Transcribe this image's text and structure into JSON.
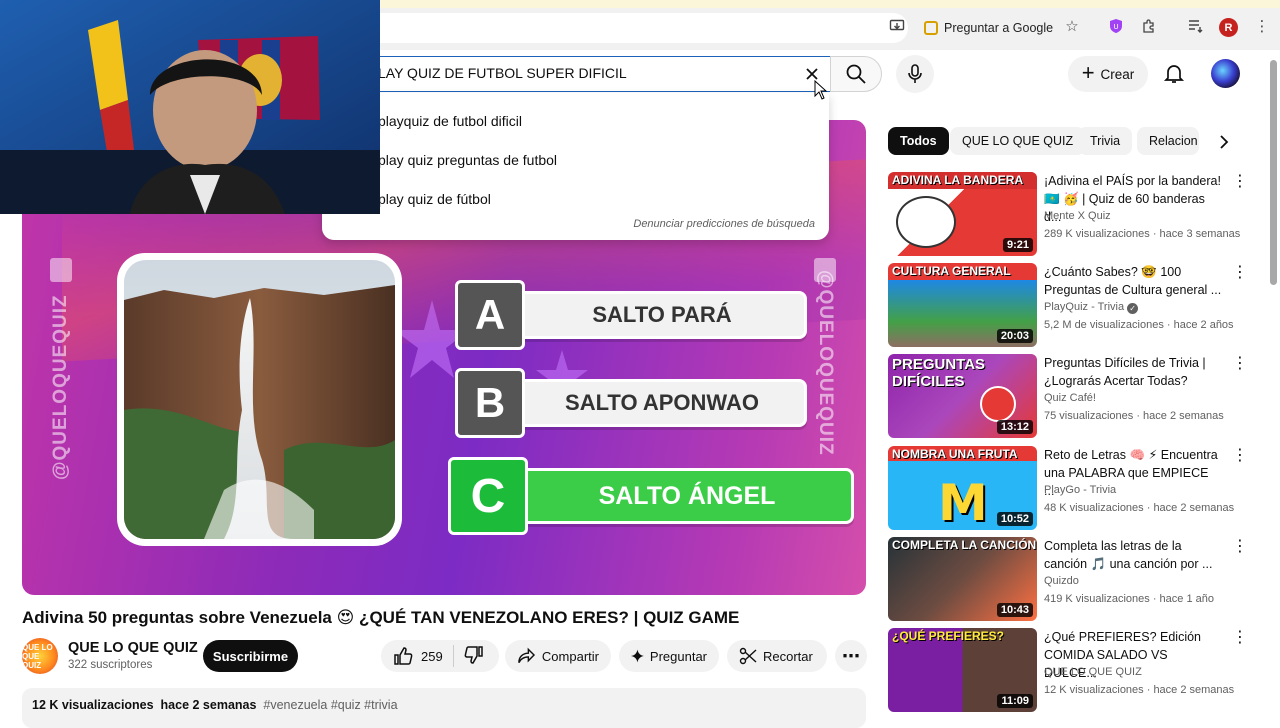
{
  "browser": {
    "ask_google": "Preguntar a Google",
    "profile_initial": "R"
  },
  "header": {
    "search_value": "LAY QUIZ DE FUTBOL SUPER DIFICIL",
    "create_label": "Crear"
  },
  "suggestions": {
    "items": [
      "playquiz de futbol dificil",
      "play quiz preguntas de futbol",
      "play quiz de fútbol"
    ],
    "report": "Denunciar predicciones de búsqueda"
  },
  "player": {
    "watermark": "@QUELOQUEQUIZ",
    "options": [
      {
        "letter": "A",
        "text": "SALTO PARÁ",
        "correct": false
      },
      {
        "letter": "B",
        "text": "SALTO APONWAO",
        "correct": false
      },
      {
        "letter": "C",
        "text": "SALTO ÁNGEL",
        "correct": true
      }
    ]
  },
  "video": {
    "title": "Adivina 50 preguntas sobre Venezuela 😍 ¿QUÉ TAN VENEZOLANO ERES? | QUIZ GAME",
    "channel": "QUE LO QUE QUIZ",
    "avatar_text": "QUE LO QUE QUIZ",
    "subscribers": "322 suscriptores",
    "subscribe": "Suscribirme",
    "likes": "259",
    "share": "Compartir",
    "ask": "Preguntar",
    "clip": "Recortar",
    "views": "12 K visualizaciones",
    "ago": "hace 2 semanas",
    "tags": "#venezuela #quiz #trivia"
  },
  "chips": [
    "Todos",
    "QUE LO QUE QUIZ",
    "Trivia",
    "Relacion"
  ],
  "recommendations": [
    {
      "title": "¡Adivina el PAÍS por la bandera! 🇰🇿 🥳 | Quiz de 60 banderas d...",
      "channel": "Mente X Quiz",
      "meta": "289 K visualizaciones · hace 3 semanas",
      "duration": "9:21",
      "thumb_text": "ADIVINA LA BANDERA",
      "verified": false
    },
    {
      "title": "¿Cuánto Sabes? 🤓 100 Preguntas de Cultura general ...",
      "channel": "PlayQuiz - Trivia",
      "meta": "5,2 M de visualizaciones · hace 2 años",
      "duration": "20:03",
      "thumb_text": "CULTURA GENERAL",
      "verified": true
    },
    {
      "title": "Preguntas Difíciles de Trivia | ¿Lograrás Acertar Todas?",
      "channel": "Quiz Café!",
      "meta": "75 visualizaciones · hace 2 semanas",
      "duration": "13:12",
      "thumb_text": "PREGUNTAS DIFÍCILES",
      "verified": false
    },
    {
      "title": "Reto de Letras 🧠 ⚡ Encuentra una PALABRA que EMPIECE ...",
      "channel": "PlayGo - Trivia",
      "meta": "48 K visualizaciones · hace 2 semanas",
      "duration": "10:52",
      "thumb_text": "NOMBRA UNA FRUTA",
      "verified": false
    },
    {
      "title": "Completa las letras de la canción 🎵 una canción por ...",
      "channel": "Quizdo",
      "meta": "419 K visualizaciones · hace 1 año",
      "duration": "10:43",
      "thumb_text": "COMPLETA LA CANCIÓN",
      "verified": false
    },
    {
      "title": "¿Qué PREFIERES? Edición COMIDA SALADO VS DULCE...",
      "channel": "QUE LO QUE QUIZ",
      "meta": "12 K visualizaciones · hace 2 semanas",
      "duration": "11:09",
      "thumb_text": "¿QUÉ PREFIERES?",
      "verified": false
    }
  ],
  "colors": {
    "accent_blue": "#1c62b9",
    "correct_green": "#1cbb3a",
    "player_purple": "#8e2bb8"
  }
}
